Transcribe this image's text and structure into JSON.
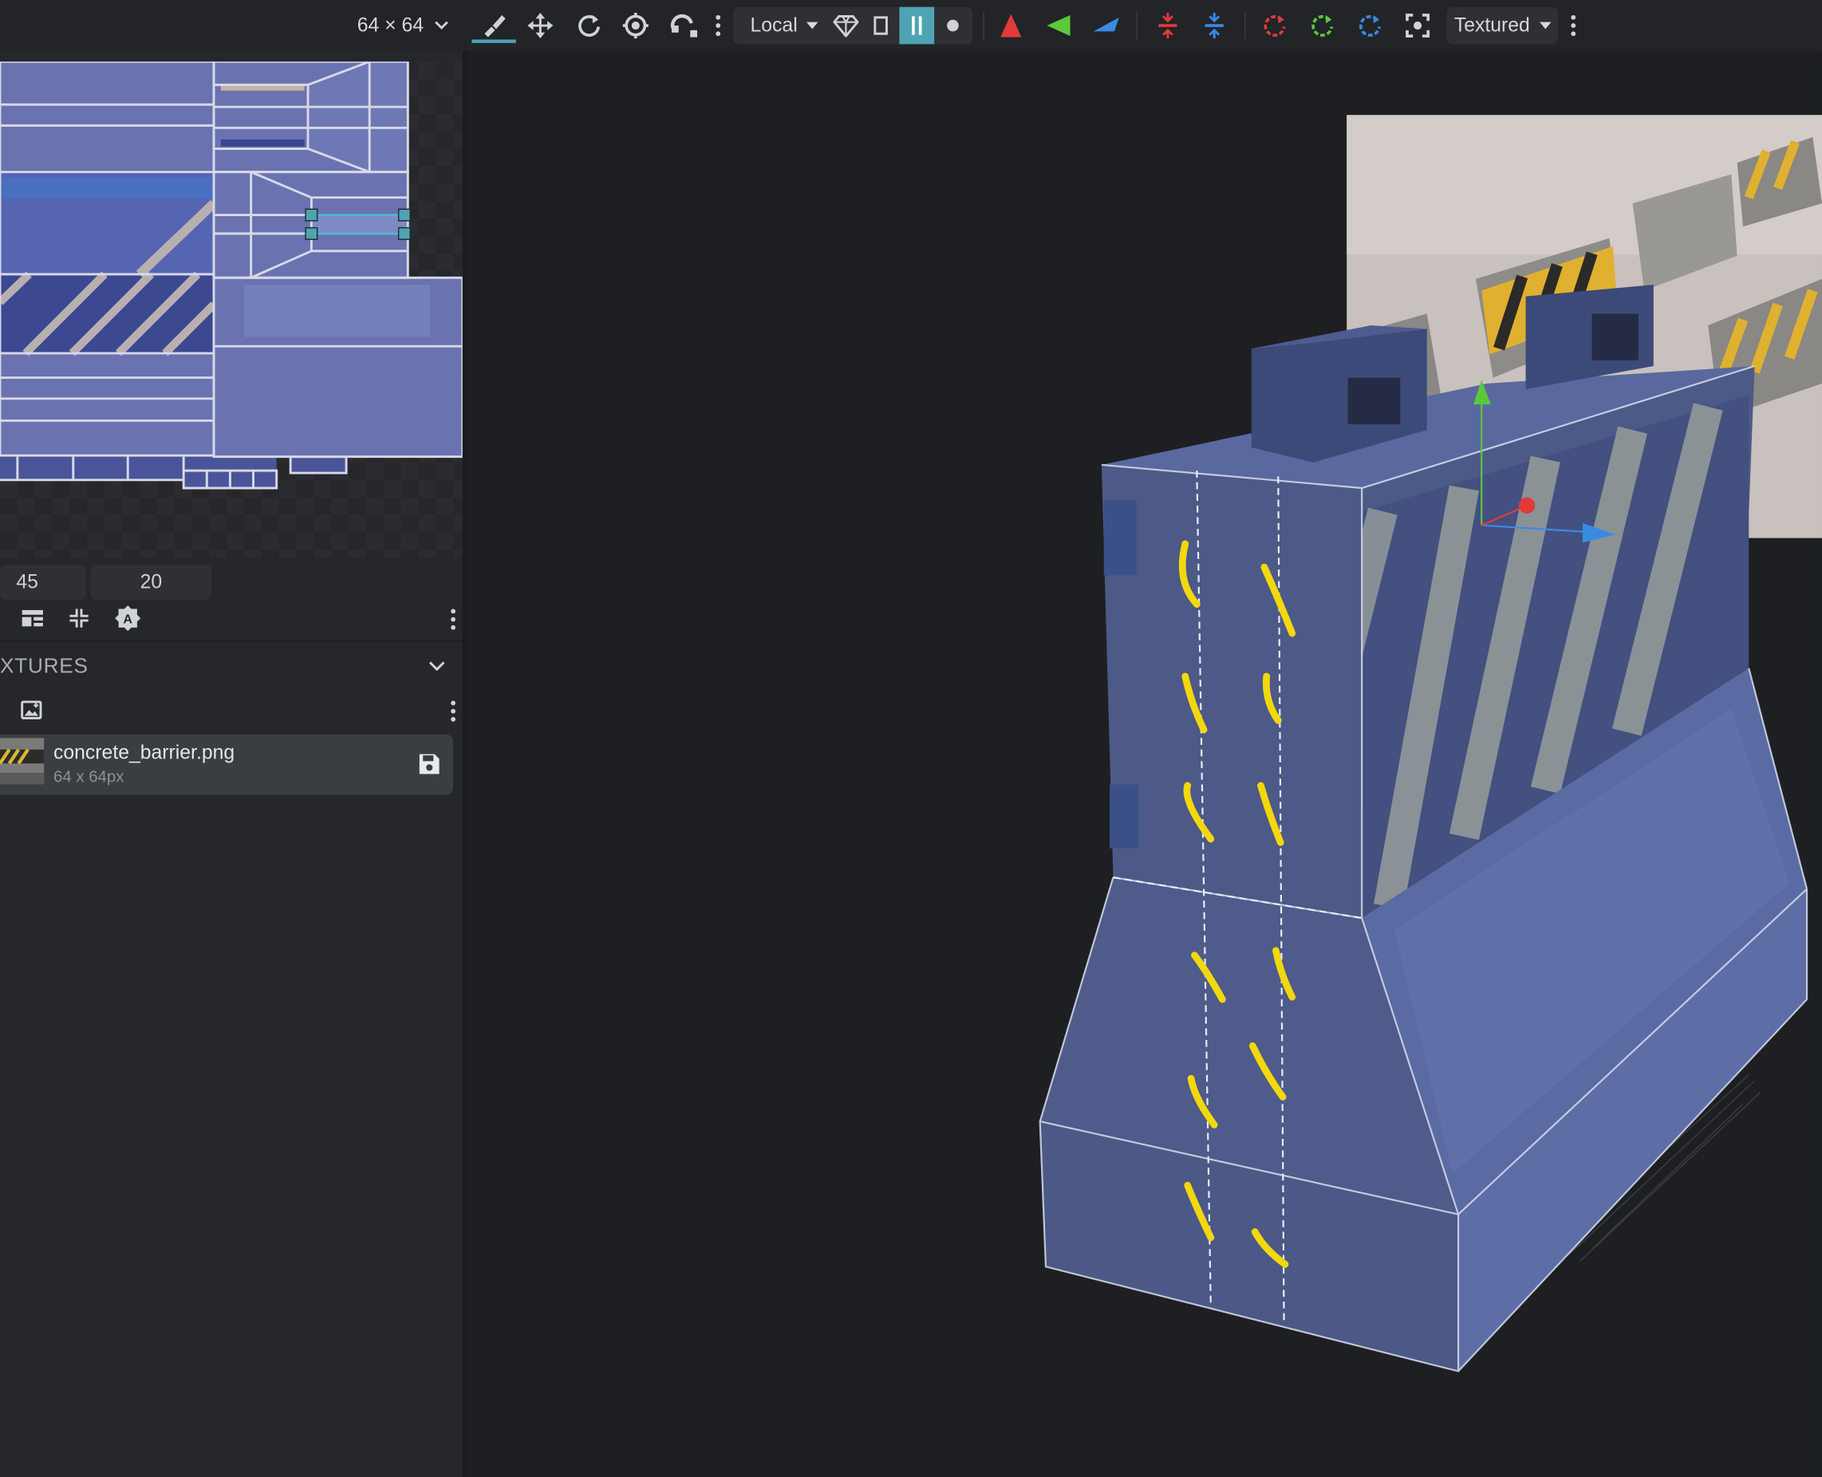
{
  "toolbar": {
    "resolution_label": "64 × 64",
    "space_dropdown": "Local",
    "render_mode_dropdown": "Textured",
    "tools": [
      "paint-brush-icon",
      "move-icon",
      "rotate-icon",
      "pivot-icon",
      "vertex-snap-icon"
    ],
    "mirror_axes": [
      "x-axis-icon",
      "y-axis-icon",
      "z-axis-icon"
    ],
    "colors": {
      "x": "#e23a3a",
      "y": "#59c93a",
      "z": "#3a8ae2",
      "active": "#4fa3b3"
    }
  },
  "uv_panel": {
    "field_a": "45",
    "field_b": "20"
  },
  "textures": {
    "section_title": "XTURES",
    "items": [
      {
        "name": "concrete_barrier.png",
        "size": "64 x 64px"
      }
    ]
  }
}
